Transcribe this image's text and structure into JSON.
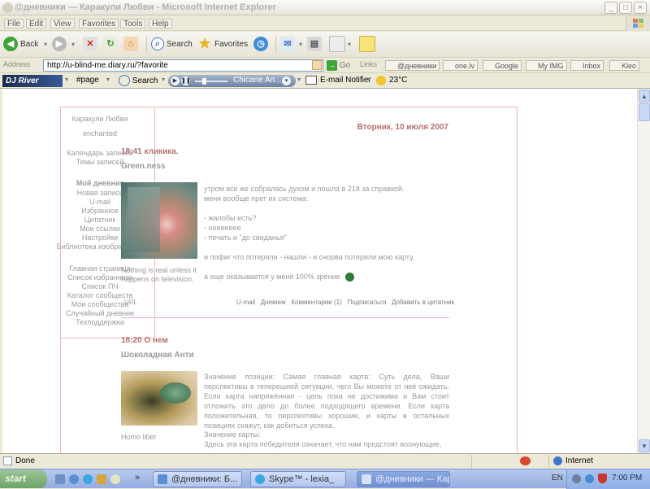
{
  "window": {
    "title": "@дневники — Каракули Любви - Microsoft Internet Explorer",
    "min_glyph": "_",
    "max_glyph": "□",
    "close_glyph": "×"
  },
  "menu": [
    "File",
    "Edit",
    "View",
    "Favorites",
    "Tools",
    "Help"
  ],
  "toolbar": {
    "back": "Back",
    "search": "Search",
    "favorites": "Favorites"
  },
  "address": {
    "label": "Address",
    "url": "http://u-blind-me.diary.ru/?favorite",
    "go": "Go",
    "links_label": "Links",
    "links": [
      "@дневники",
      "one.lv",
      "Google",
      "My IMG",
      "Inbox",
      "Kleo"
    ]
  },
  "toolbar2": {
    "brand": "DJ River",
    "page": "#page",
    "search": "Search",
    "track": "Chicane An...",
    "email": "E-mail Notifier",
    "temp": "23°C"
  },
  "diary": {
    "title": "Каракули Любви",
    "subtitle": "enchanted",
    "date": "Вторник, 10 июля 2007",
    "sidebar": {
      "group1": [
        "Календарь записей",
        "Темы записей"
      ],
      "my_diary_label": "Мой дневник",
      "group2": [
        "Новая запись",
        "U-mail",
        "Избранное",
        "Цитатник",
        "Мои ссылки",
        "Настройки",
        "Библиотека изображений"
      ],
      "group3": [
        "Главная страница",
        "Список избранного",
        "Список ПЧ",
        "Каталог сообществ",
        "Мои сообщества",
        "Случайный дневник",
        "Техподдержка"
      ]
    },
    "posts": [
      {
        "time_title": "18:41 кликика.",
        "author": "Green.ness",
        "caption": "Nothing is real unless it happens on television.",
        "lines": [
          "утром все же собралась духом и пошла в 218 за справкой.",
          "меня вообще прет их система:",
          "",
          "- жалобы есть?",
          "- неееееее",
          "- печать и \"до свиданья\"",
          "",
          "и пофиг что потеряли - нашли - и снорва потеряли мою карту.",
          "",
          "а еще оказывается у меня 100% зрение"
        ],
        "url_label": "URL",
        "actions": [
          "U-mail",
          "Дневник",
          "Комментарии (1)",
          "Подписаться",
          "Добавить в цитатник"
        ]
      },
      {
        "time_title": "18:20 О нем",
        "author": "Шоколадная Анти",
        "caption": "Homo liber",
        "text": "Значение позиции: Самая главная карта: Суть дела, Ваши перспективы в теперешней ситуации, чего Вы можете от неё ожидать. Если карта напряжённая - цель пока не достижима и Вам стоит отложить это дело до более подходящего времени. Если карта положительная, то перспективы хорошие, и карты в остальных позициях скажут, как добиться успеха.",
        "text2_title": "Значение карты:",
        "text2": "Здесь эта карта победителя означает, что нам предстоят волнующие,"
      }
    ]
  },
  "status": {
    "text": "Done",
    "zone": "Internet"
  },
  "taskbar": {
    "start": "start",
    "lang": "EN",
    "clock": "7:00 PM",
    "tasks": [
      "@дневники: Б...",
      "Skype™ - lexia_",
      "@дневники — Кар..."
    ]
  },
  "colors": {
    "accent": "#b76e6e",
    "pale_text": "#9a9a9a"
  }
}
